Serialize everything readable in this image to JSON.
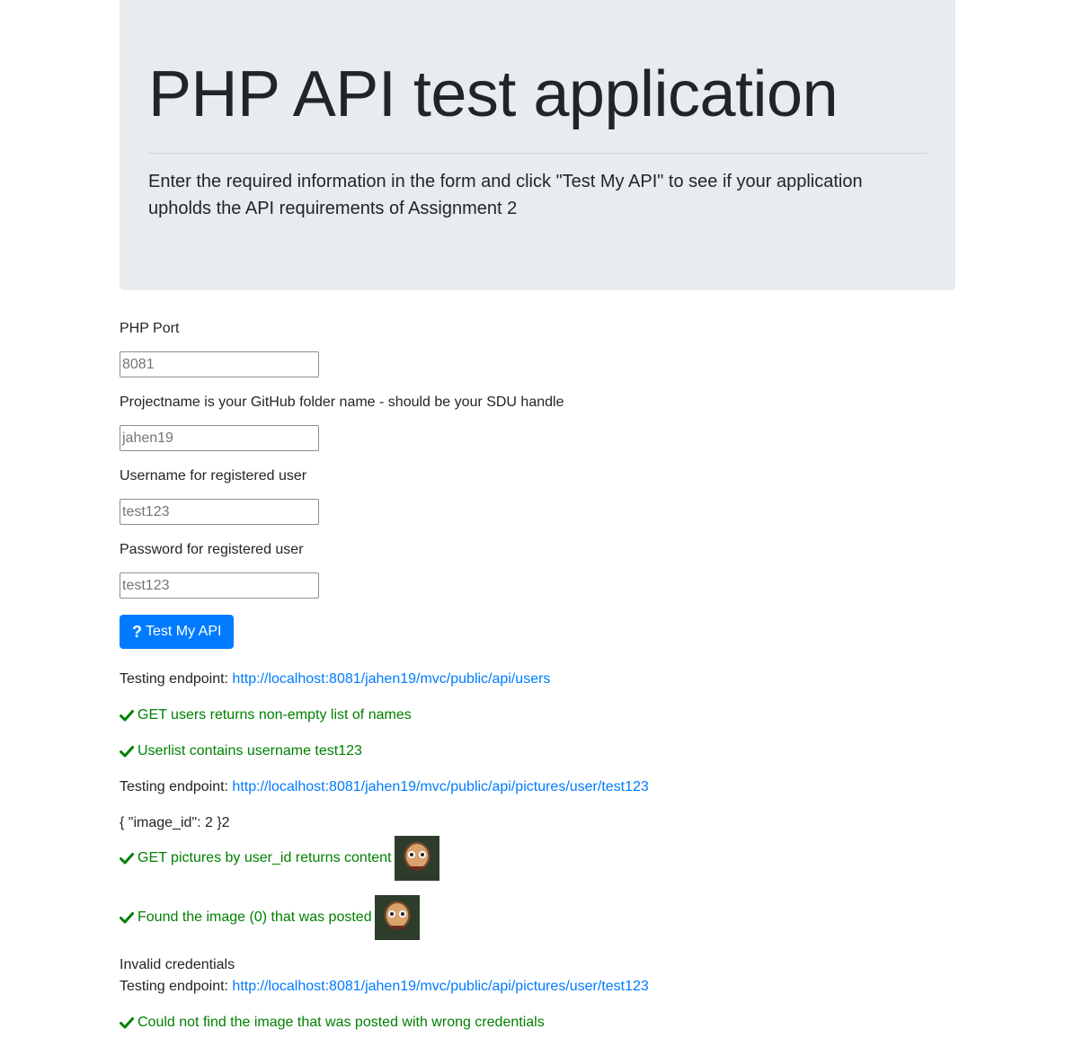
{
  "header": {
    "title": "PHP API test application",
    "lead_before": "Enter the required information in the form and click ",
    "lead_button_ref": "\"Test My API\"",
    "lead_after": " to see if your application upholds the API requirements of Assignment 2"
  },
  "form": {
    "port_label": "PHP Port",
    "port_placeholder": "8081",
    "project_label": "Projectname is your GitHub folder name - should be your SDU handle",
    "project_placeholder": "jahen19",
    "username_label": "Username for registered user",
    "username_placeholder": "test123",
    "password_label": "Password for registered user",
    "password_placeholder": "test123",
    "submit_label": "Test My API",
    "submit_icon": "question-icon"
  },
  "results": {
    "endpoint_prefix": "Testing endpoint: ",
    "endpoint_users": "http://localhost:8081/jahen19/mvc/public/api/users",
    "check_get_users": "GET users returns non-empty list of names",
    "check_userlist": "Userlist contains username test123",
    "endpoint_pictures": "http://localhost:8081/jahen19/mvc/public/api/pictures/user/test123",
    "image_json": "{ \"image_id\": 2 }2",
    "check_get_pictures": "GET pictures by user_id returns content",
    "check_found_image": "Found the image (0) that was posted",
    "invalid_credentials": "Invalid credentials",
    "endpoint_pictures_2": "http://localhost:8081/jahen19/mvc/public/api/pictures/user/test123",
    "check_not_found": "Could not find the image that was posted with wrong credentials",
    "success_color": "#008000",
    "link_color": "#007bff"
  }
}
